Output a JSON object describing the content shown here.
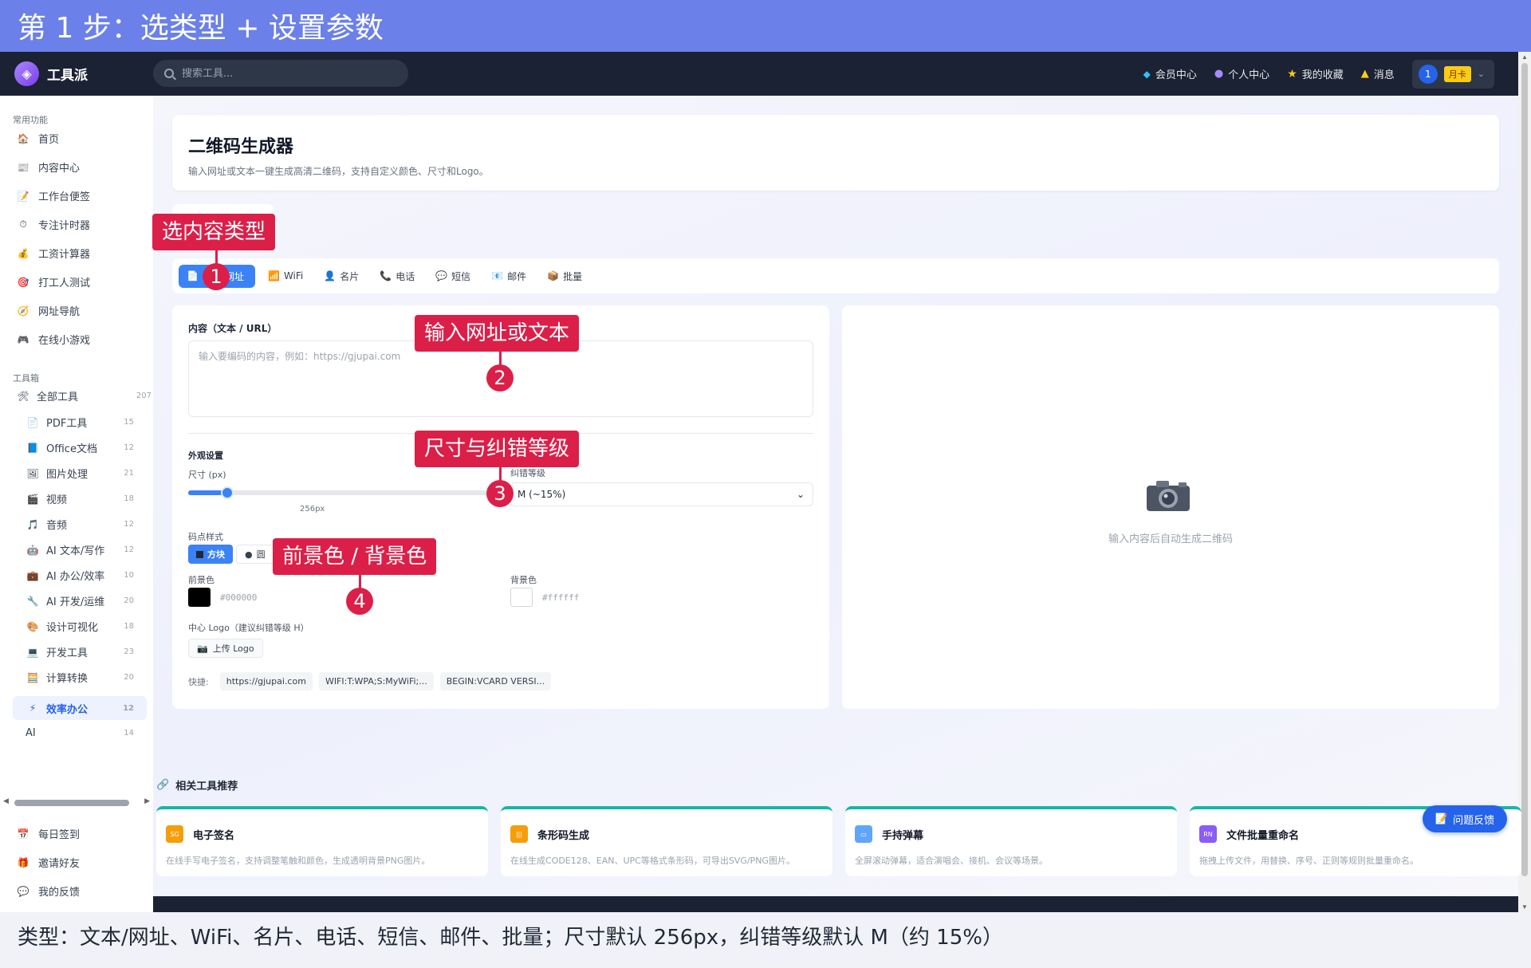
{
  "banner": "第 1 步：选类型 + 设置参数",
  "topbar": {
    "app_name": "工具派",
    "search_placeholder": "搜索工具...",
    "nav": [
      "会员中心",
      "个人中心",
      "我的收藏",
      "消息"
    ],
    "user_number": "1",
    "card_badge": "月卡"
  },
  "sidebar": {
    "common_title": "常用功能",
    "common_items": [
      {
        "icon": "🏠",
        "label": "首页"
      },
      {
        "icon": "📰",
        "label": "内容中心"
      },
      {
        "icon": "📝",
        "label": "工作台便签"
      },
      {
        "icon": "⏱",
        "label": "专注计时器"
      },
      {
        "icon": "💰",
        "label": "工资计算器"
      },
      {
        "icon": "🎯",
        "label": "打工人测试"
      },
      {
        "icon": "🧭",
        "label": "网址导航"
      },
      {
        "icon": "🎮",
        "label": "在线小游戏"
      }
    ],
    "toolbox_title": "工具箱",
    "all_tools": {
      "icon": "🛠",
      "label": "全部工具",
      "count": "207"
    },
    "tool_items": [
      {
        "icon": "📄",
        "label": "PDF工具",
        "count": "15"
      },
      {
        "icon": "📘",
        "label": "Office文档",
        "count": "12"
      },
      {
        "icon": "🖼",
        "label": "图片处理",
        "count": "21"
      },
      {
        "icon": "🎬",
        "label": "视频",
        "count": "18"
      },
      {
        "icon": "🎵",
        "label": "音频",
        "count": "12"
      },
      {
        "icon": "🤖",
        "label": "AI 文本/写作",
        "count": "12"
      },
      {
        "icon": "💼",
        "label": "AI 办公/效率",
        "count": "10"
      },
      {
        "icon": "🔧",
        "label": "AI 开发/运维",
        "count": "20"
      },
      {
        "icon": "🎨",
        "label": "设计可视化",
        "count": "18"
      },
      {
        "icon": "💻",
        "label": "开发工具",
        "count": "23"
      },
      {
        "icon": "🧮",
        "label": "计算转换",
        "count": "20"
      }
    ],
    "active_item": {
      "icon": "⚡",
      "label": "效率办公",
      "count": "12"
    },
    "ai_item": {
      "label": "AI",
      "count": "14"
    },
    "bottom_items": [
      {
        "icon": "📅",
        "label": "每日签到"
      },
      {
        "icon": "🎁",
        "label": "邀请好友"
      },
      {
        "icon": "💬",
        "label": "我的反馈"
      }
    ]
  },
  "page": {
    "title": "二维码生成器",
    "subtitle": "输入网址或文本一键生成高清二维码，支持自定义颜色、尺寸和Logo。"
  },
  "types": [
    {
      "icon": "📄",
      "label": "文本/网址"
    },
    {
      "icon": "📶",
      "label": "WiFi"
    },
    {
      "icon": "👤",
      "label": "名片"
    },
    {
      "icon": "📞",
      "label": "电话"
    },
    {
      "icon": "💬",
      "label": "短信"
    },
    {
      "icon": "📧",
      "label": "邮件"
    },
    {
      "icon": "📦",
      "label": "批量"
    }
  ],
  "form": {
    "content_label": "内容（文本 / URL）",
    "content_placeholder": "输入要编码的内容，例如：https://gjupai.com",
    "appearance_label": "外观设置",
    "size_label": "尺寸 (px)",
    "size_value_text": "256px",
    "size_value_fraction": 0.1,
    "ecc_label": "纠错等级",
    "ecc_value": "M (~15%)",
    "dot_style_label": "码点样式",
    "dot_style_active": "方块",
    "dot_style_other": "圆",
    "fg_label": "前景色",
    "fg_value": "#000000",
    "bg_label": "背景色",
    "bg_value": "#ffffff",
    "logo_label": "中心 Logo（建议纠错等级 H）",
    "upload_label": "上传 Logo",
    "quick_label": "快捷:",
    "quick_chips": [
      "https://gjupai.com",
      "WIFI:T:WPA;S:MyWiFi;...",
      "BEGIN:VCARD VERSI..."
    ]
  },
  "preview": {
    "placeholder": "输入内容后自动生成二维码"
  },
  "related": {
    "title": "相关工具推荐",
    "cards": [
      {
        "icon_text": "SG",
        "icon_color": "#f59e0b",
        "title": "电子签名",
        "desc": "在线手写电子签名，支持调整笔触和颜色，生成透明背景PNG图片。"
      },
      {
        "icon_text": "|||",
        "icon_color": "#f59e0b",
        "title": "条形码生成",
        "desc": "在线生成CODE128、EAN、UPC等格式条形码，可导出SVG/PNG图片。"
      },
      {
        "icon_text": "▭",
        "icon_color": "#60a5fa",
        "title": "手持弹幕",
        "desc": "全屏滚动弹幕，适合演唱会、接机、会议等场景。"
      },
      {
        "icon_text": "RN",
        "icon_color": "#8b5cf6",
        "title": "文件批量重命名",
        "desc": "拖拽上传文件，用替换、序号、正则等规则批量重命名。"
      }
    ]
  },
  "feedback_button": "问题反馈",
  "callouts": [
    {
      "text": "选内容类型",
      "num": "1"
    },
    {
      "text": "输入网址或文本",
      "num": "2"
    },
    {
      "text": "尺寸与纠错等级",
      "num": "3"
    },
    {
      "text": "前景色 / 背景色",
      "num": "4"
    }
  ],
  "footer": "类型：文本/网址、WiFi、名片、电话、短信、邮件、批量；尺寸默认 256px，纠错等级默认 M（约 15%）",
  "colors": {
    "accent": "#3b82f6",
    "banner": "#6b80e8",
    "callout": "#dc1f48",
    "topbar": "#1b2233"
  }
}
